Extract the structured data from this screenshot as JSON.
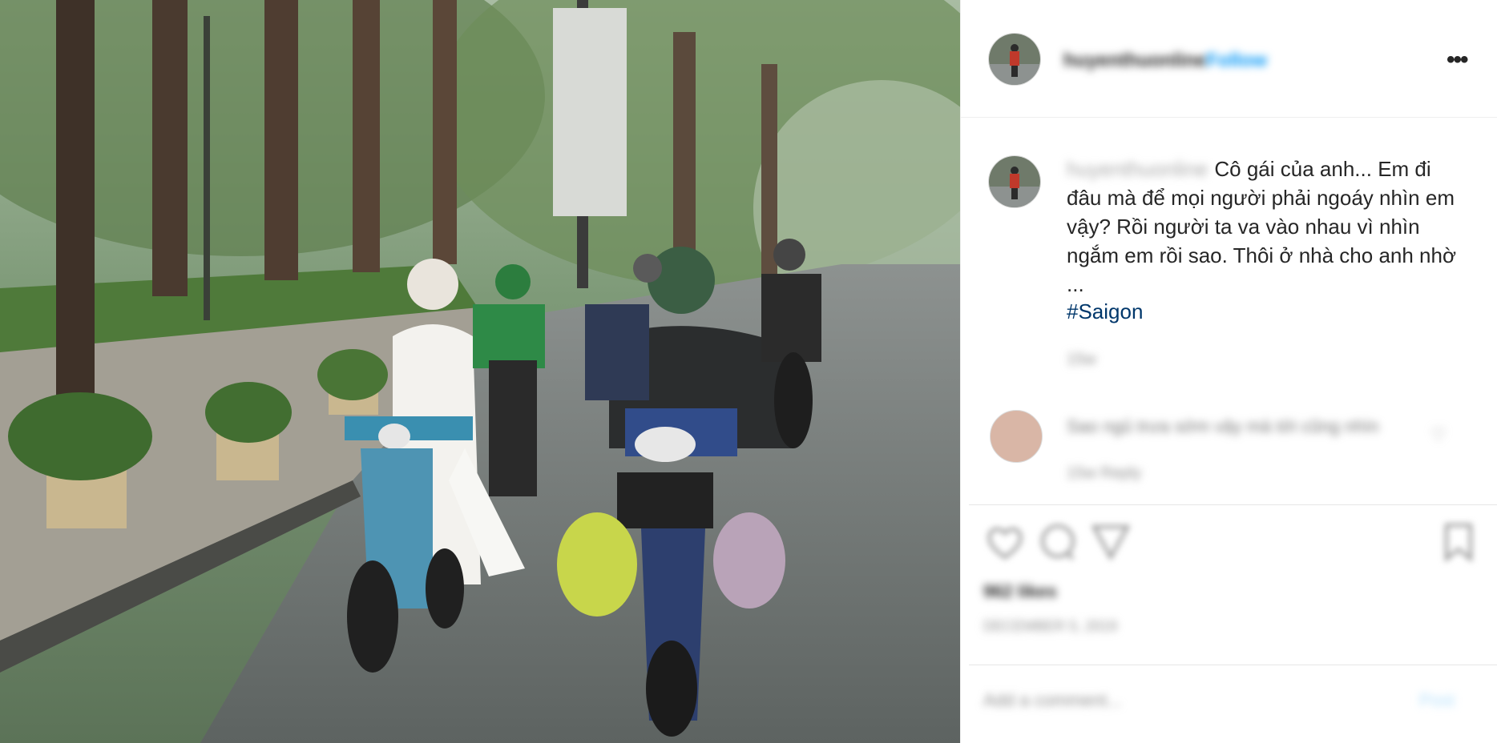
{
  "post": {
    "username": "huyenthuonline",
    "follow_label": "Follow",
    "more_label": "•••",
    "caption_user": "huyenthuonline",
    "caption_text": "Cô gái của anh... Em đi đâu mà để mọi người phải ngoáy nhìn em vậy? Rồi người ta va vào nhau vì nhìn ngắm em rồi sao. Thôi ở nhà cho anh nhờ ...",
    "hashtag": "#Saigon",
    "caption_time": "15w"
  },
  "comment": {
    "text": "Sao ngủ trưa sớm vậy mà tới cũng nhìn",
    "meta": "15w   Reply"
  },
  "actions": {
    "likes": "962 likes",
    "date": "DECEMBER 5, 2019"
  },
  "add_comment": {
    "placeholder": "Add a comment...",
    "post_label": "Post"
  },
  "icons": [
    "heart-icon",
    "comment-icon",
    "share-icon",
    "bookmark-icon",
    "more-icon"
  ],
  "colors": {
    "link": "#00376b",
    "follow": "#0095f6",
    "text": "#262626",
    "muted": "#8e8e8e"
  }
}
